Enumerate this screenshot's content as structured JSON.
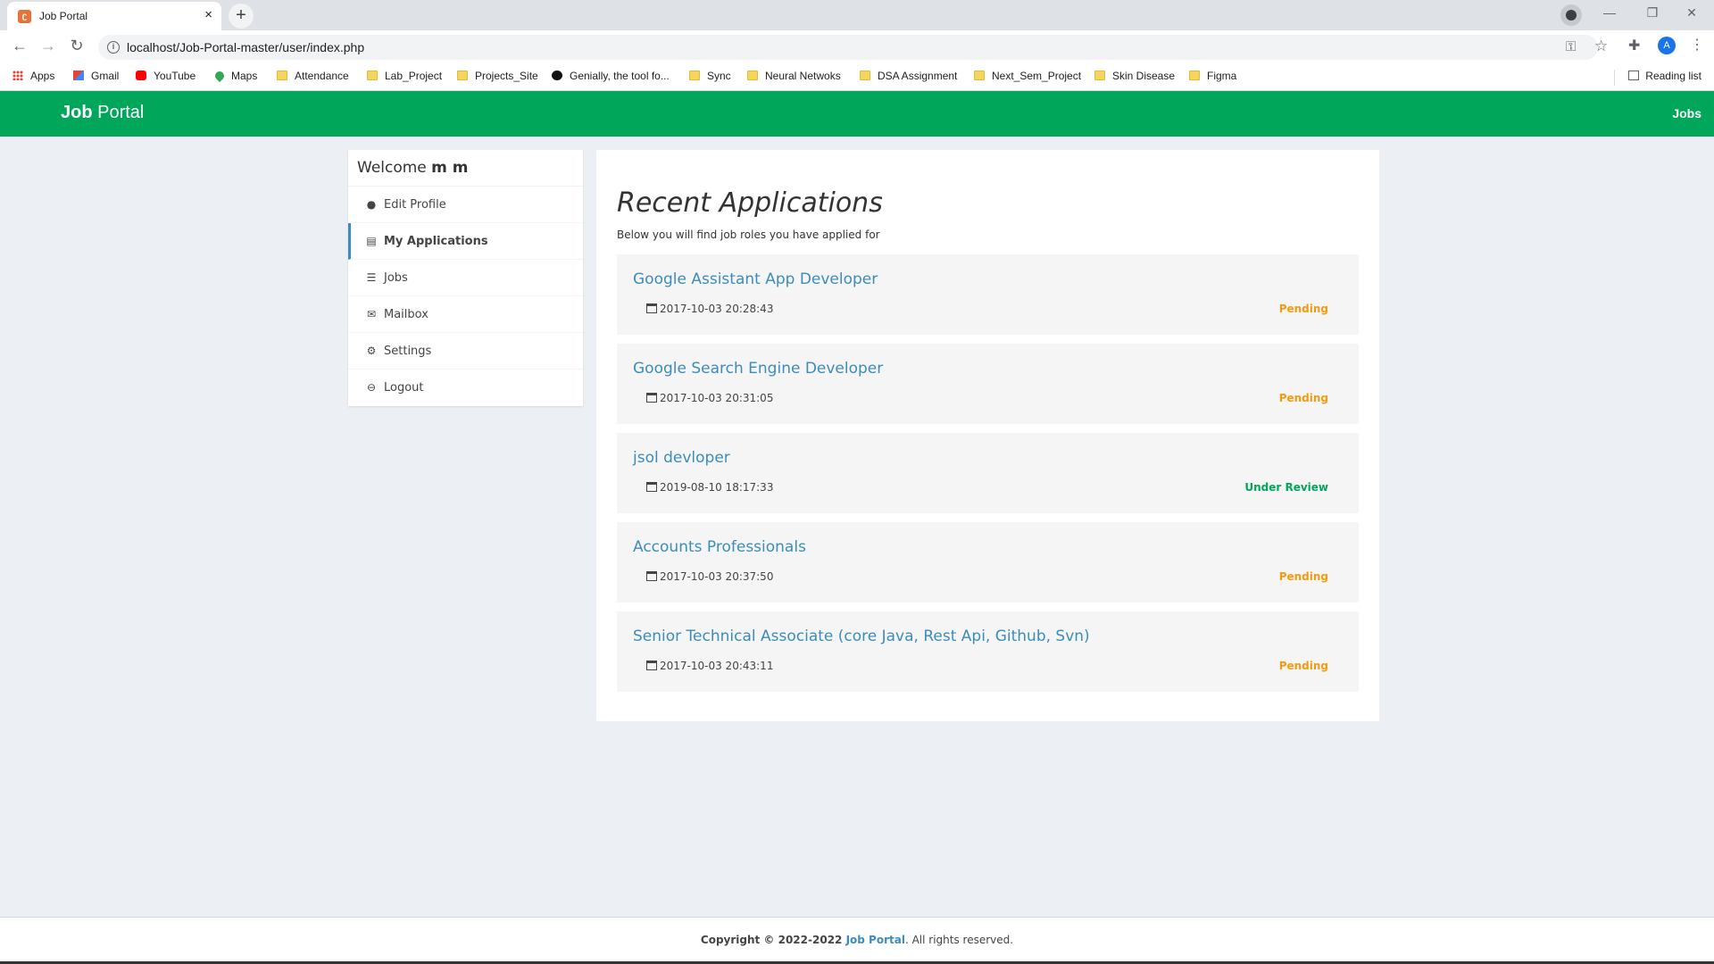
{
  "browser": {
    "tab_title": "Job Portal",
    "tab_close": "×",
    "new_tab": "+",
    "url": "localhost/Job-Portal-master/user/index.php",
    "bookmarks": [
      {
        "label": "Apps",
        "icon": "apps-grid-icon"
      },
      {
        "label": "Gmail",
        "icon": "gmail-icon"
      },
      {
        "label": "YouTube",
        "icon": "youtube-icon"
      },
      {
        "label": "Maps",
        "icon": "maps-icon"
      },
      {
        "label": "Attendance",
        "icon": "folder-icon"
      },
      {
        "label": "Lab_Project",
        "icon": "folder-icon"
      },
      {
        "label": "Projects_Site",
        "icon": "folder-icon"
      },
      {
        "label": "Genially, the tool fo...",
        "icon": "genially-icon"
      },
      {
        "label": "Sync",
        "icon": "folder-icon"
      },
      {
        "label": "Neural Netwoks",
        "icon": "folder-icon"
      },
      {
        "label": "DSA Assignment",
        "icon": "folder-icon"
      },
      {
        "label": "Next_Sem_Project",
        "icon": "folder-icon"
      },
      {
        "label": "Skin Disease",
        "icon": "folder-icon"
      },
      {
        "label": "Figma",
        "icon": "folder-icon"
      }
    ],
    "reading_list": "Reading list",
    "profile_initial": "A"
  },
  "header": {
    "brand_bold": "Job",
    "brand_rest": " Portal",
    "nav_jobs": "Jobs",
    "color": "#00a65a"
  },
  "sidebar": {
    "welcome_prefix": "Welcome ",
    "welcome_name": "m m",
    "items": [
      {
        "label": "Edit Profile",
        "icon": "user-icon",
        "active": false
      },
      {
        "label": "My Applications",
        "icon": "id-card-icon",
        "active": true
      },
      {
        "label": "Jobs",
        "icon": "list-icon",
        "active": false
      },
      {
        "label": "Mailbox",
        "icon": "envelope-icon",
        "active": false
      },
      {
        "label": "Settings",
        "icon": "gear-icon",
        "active": false
      },
      {
        "label": "Logout",
        "icon": "logout-icon",
        "active": false
      }
    ]
  },
  "main": {
    "title": "Recent Applications",
    "subtitle": "Below you will find job roles you have applied for",
    "applications": [
      {
        "title": "Google Assistant App Developer",
        "date": "2017-10-03 20:28:43",
        "status": "Pending",
        "status_color": "#f39c12"
      },
      {
        "title": "Google Search Engine Developer",
        "date": "2017-10-03 20:31:05",
        "status": "Pending",
        "status_color": "#f39c12"
      },
      {
        "title": "jsol devloper",
        "date": "2019-08-10 18:17:33",
        "status": "Under Review",
        "status_color": "#00a65a"
      },
      {
        "title": "Accounts Professionals",
        "date": "2017-10-03 20:37:50",
        "status": "Pending",
        "status_color": "#f39c12"
      },
      {
        "title": "Senior Technical Associate (core Java, Rest Api, Github, Svn)",
        "date": "2017-10-03 20:43:11",
        "status": "Pending",
        "status_color": "#f39c12"
      }
    ]
  },
  "footer": {
    "copyright": "Copyright © 2022-2022 ",
    "link": "Job Portal",
    "rest": ". All rights reserved."
  }
}
